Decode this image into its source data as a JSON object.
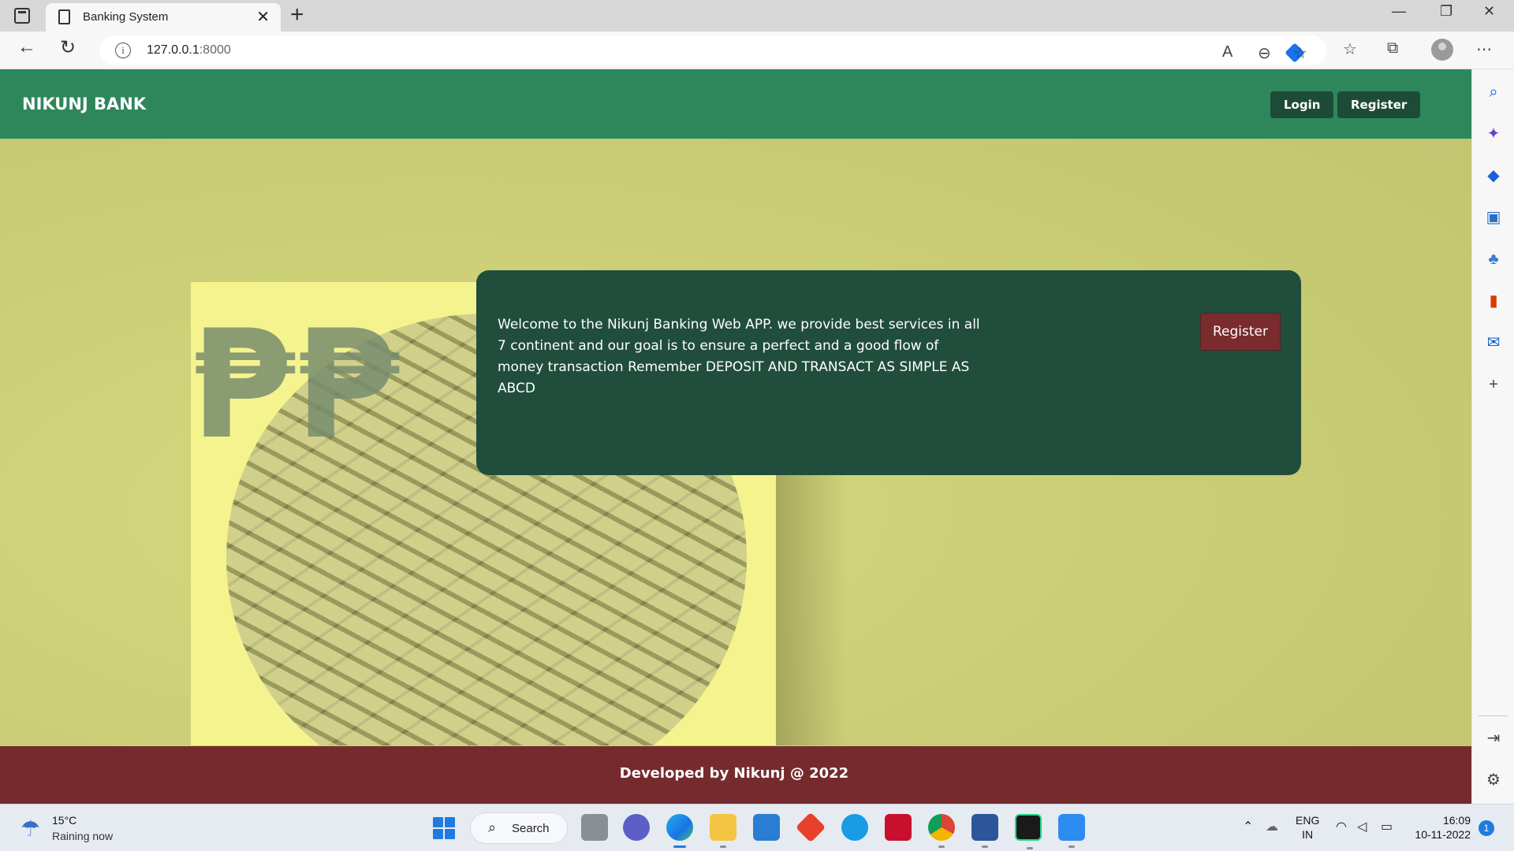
{
  "browser": {
    "tab_title": "Banking System",
    "url_host": "127.0.0.1",
    "url_port": ":8000"
  },
  "navbar": {
    "brand": "NIKUNJ BANK",
    "login_label": "Login",
    "register_label": "Register"
  },
  "hero": {
    "rupee_symbols": "₱₱",
    "welcome_text": "Welcome to the Nikunj Banking Web APP. we provide best services in all 7 continent and our goal is to ensure a perfect and a good flow of money transaction Remember DEPOSIT AND TRANSACT AS SIMPLE AS ABCD",
    "register_label": "Register"
  },
  "footer": {
    "text": "Developed by Nikunj @ 2022"
  },
  "taskbar": {
    "weather_temp": "15°C",
    "weather_desc": "Raining now",
    "search_label": "Search",
    "lang_line1": "ENG",
    "lang_line2": "IN",
    "time": "16:09",
    "date": "10-11-2022",
    "notification_count": "1"
  },
  "colors": {
    "navbar": "#2e875a",
    "nav_button": "#1e4b37",
    "card": "#214d3c",
    "card_button": "#7a2b2e",
    "footer": "#752b2d",
    "page_bg": "#c9cd7a"
  }
}
